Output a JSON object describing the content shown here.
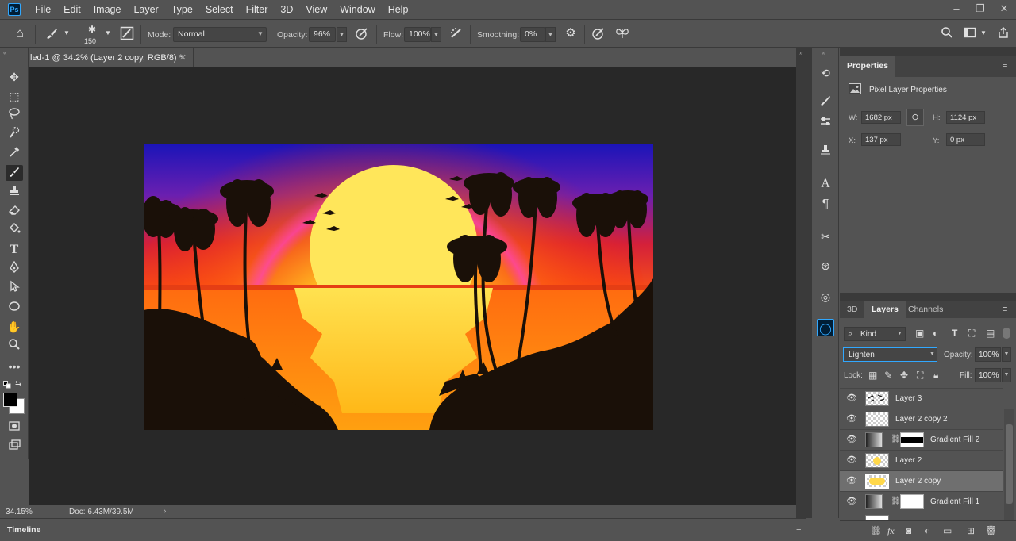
{
  "app": {
    "logo": "Ps"
  },
  "menu": [
    "File",
    "Edit",
    "Image",
    "Layer",
    "Type",
    "Select",
    "Filter",
    "3D",
    "View",
    "Window",
    "Help"
  ],
  "window_controls": [
    "–",
    "❐",
    "✕"
  ],
  "options_bar": {
    "brush_size": "150",
    "mode_label": "Mode:",
    "mode_value": "Normal",
    "opacity_label": "Opacity:",
    "opacity_value": "96%",
    "flow_label": "Flow:",
    "flow_value": "100%",
    "smoothing_label": "Smoothing:",
    "smoothing_value": "0%"
  },
  "document": {
    "tab_title": "led-1 @ 34.2% (Layer 2 copy, RGB/8) *",
    "zoom": "34.15%",
    "doc_info": "Doc: 6.43M/39.5M"
  },
  "timeline": {
    "label": "Timeline"
  },
  "properties": {
    "tab": "Properties",
    "section_title": "Pixel Layer Properties",
    "w_label": "W:",
    "w_value": "1682 px",
    "h_label": "H:",
    "h_value": "1124 px",
    "x_label": "X:",
    "x_value": "137 px",
    "y_label": "Y:",
    "y_value": "0 px"
  },
  "layers_panel": {
    "tabs": [
      "3D",
      "Layers",
      "Channels"
    ],
    "active_tab": "Layers",
    "filter_value": "Kind",
    "blend_mode": "Lighten",
    "opacity_label": "Opacity:",
    "opacity_value": "100%",
    "lock_label": "Lock:",
    "fill_label": "Fill:",
    "fill_value": "100%",
    "layers": [
      {
        "name": "Layer 3",
        "selected": false
      },
      {
        "name": "Layer 2 copy 2",
        "selected": false
      },
      {
        "name": "Gradient Fill 2",
        "selected": false
      },
      {
        "name": "Layer 2",
        "selected": false
      },
      {
        "name": "Layer 2 copy",
        "selected": true
      },
      {
        "name": "Gradient Fill 1",
        "selected": false
      }
    ]
  },
  "colors": {
    "accent": "#31a8ff",
    "ui_bg": "#535353",
    "canvas_bg": "#282828"
  }
}
